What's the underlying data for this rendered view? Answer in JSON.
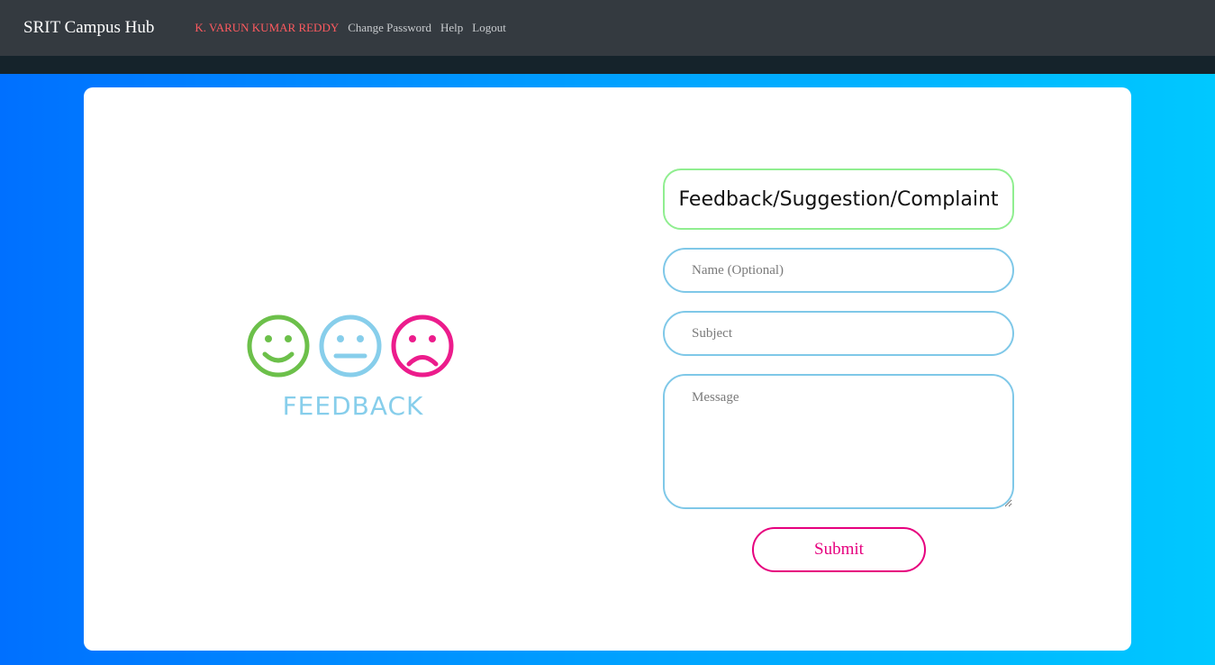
{
  "navbar": {
    "brand": "SRIT Campus Hub",
    "user": "K. VARUN KUMAR REDDY",
    "links": [
      "Change Password",
      "Help",
      "Logout"
    ]
  },
  "illustration": {
    "text": "FEEDBACK",
    "faces": [
      "happy-face-icon",
      "neutral-face-icon",
      "sad-face-icon"
    ],
    "colors": {
      "happy": "#6cc04a",
      "neutral": "#87ceeb",
      "sad": "#ec1c8c"
    }
  },
  "form": {
    "title": "Feedback/Suggestion/Complaint",
    "name_placeholder": "Name (Optional)",
    "subject_placeholder": "Subject",
    "message_placeholder": "Message",
    "submit_label": "Submit"
  },
  "colors": {
    "navbar": "#343a40",
    "user_link": "#ff5a5f",
    "title_border": "#90ee90",
    "field_border": "#7fc8e8",
    "submit_accent": "#e6007e"
  }
}
